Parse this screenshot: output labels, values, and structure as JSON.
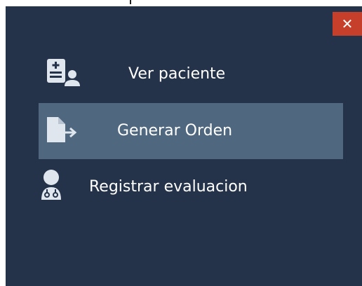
{
  "window": {
    "close_label": "✕"
  },
  "menu": {
    "items": [
      {
        "label": "Ver paciente",
        "icon": "patient-record-icon",
        "active": false
      },
      {
        "label": "Generar Orden",
        "icon": "export-document-icon",
        "active": true
      },
      {
        "label": "Registrar evaluacion",
        "icon": "doctor-icon",
        "active": false
      }
    ]
  },
  "colors": {
    "panel_bg": "#243349",
    "selected_bg": "#50687f",
    "close_bg": "#c63f2b",
    "text": "#ffffff",
    "icon": "#dfe6ee"
  }
}
